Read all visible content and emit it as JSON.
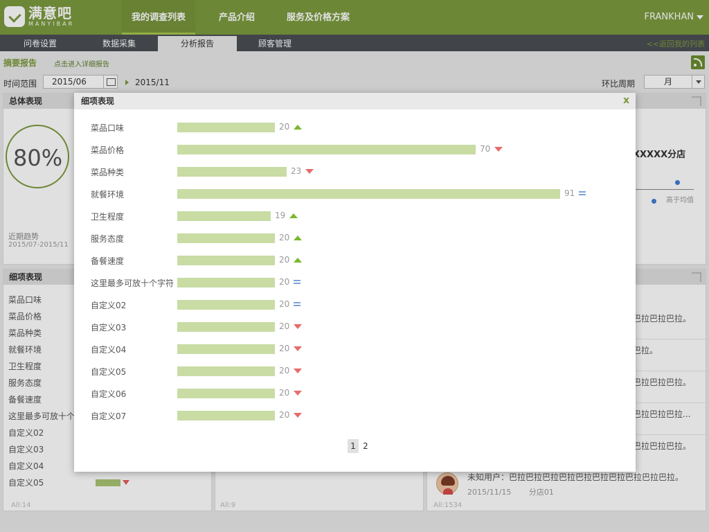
{
  "brand": {
    "name_cn": "满意吧",
    "name_en": "MANYIBAR"
  },
  "nav": {
    "items": [
      {
        "label": "我的调查列表",
        "active": true
      },
      {
        "label": "产品介绍",
        "active": false
      },
      {
        "label": "服务及价格方案",
        "active": false
      }
    ],
    "user": "FRANKHAN"
  },
  "subnav": {
    "tabs": [
      {
        "label": "问卷设置"
      },
      {
        "label": "数据采集"
      },
      {
        "label": "分析报告",
        "active": true
      },
      {
        "label": "顾客管理"
      }
    ],
    "back_link": "<<返回我的列表"
  },
  "summary": {
    "title": "摘要报告",
    "link": "点击进入详细报告"
  },
  "filters": {
    "range_label": "时间范围",
    "start": "2015/06",
    "end": "2015/11",
    "period_label": "环比周期",
    "period_value": "月"
  },
  "overall": {
    "title": "总体表现",
    "score": "80%",
    "trend_label": "近期趋势",
    "trend_range": "2015/07-2015/11"
  },
  "detail_panel": {
    "title": "细项表现",
    "items": [
      "菜品口味",
      "菜品价格",
      "菜品种类",
      "就餐环境",
      "卫生程度",
      "服务态度",
      "备餐速度",
      "这里最多可放十个",
      "自定义02",
      "自定义03",
      "自定义04",
      "自定义05"
    ],
    "footer": "All:14"
  },
  "middle_footer": "All:9",
  "right_panel": {
    "branch": "XXXXX分店",
    "avg_label": "高于均值",
    "snippets": [
      "巴拉巴拉巴拉。",
      "巴拉。",
      "巴拉巴拉巴拉。",
      "巴拉巴拉巴拉...",
      "巴拉巴拉巴拉。"
    ],
    "last_comment": {
      "text": "未知用户：巴拉巴拉巴拉巴拉巴拉巴拉巴拉巴拉巴拉巴拉。",
      "date": "2015/11/15",
      "store": "分店01"
    },
    "footer": "All:1534"
  },
  "modal": {
    "title": "细项表现",
    "close": "x",
    "rows": [
      {
        "label": "菜品口味",
        "value": 20,
        "trend": "up"
      },
      {
        "label": "菜品价格",
        "value": 70,
        "trend": "down"
      },
      {
        "label": "菜品种类",
        "value": 23,
        "trend": "down"
      },
      {
        "label": "就餐环境",
        "value": 91,
        "trend": "equal"
      },
      {
        "label": "卫生程度",
        "value": 19,
        "trend": "up"
      },
      {
        "label": "服务态度",
        "value": 20,
        "trend": "up"
      },
      {
        "label": "备餐速度",
        "value": 20,
        "trend": "up"
      },
      {
        "label": "这里最多可放十个字符",
        "value": 20,
        "trend": "equal"
      },
      {
        "label": "自定义02",
        "value": 20,
        "trend": "equal"
      },
      {
        "label": "自定义03",
        "value": 20,
        "trend": "down"
      },
      {
        "label": "自定义04",
        "value": 20,
        "trend": "down"
      },
      {
        "label": "自定义05",
        "value": 20,
        "trend": "down"
      },
      {
        "label": "自定义06",
        "value": 20,
        "trend": "down"
      },
      {
        "label": "自定义07",
        "value": 20,
        "trend": "down"
      }
    ],
    "pages": [
      "1",
      "2"
    ],
    "current_page": "1"
  },
  "colors": {
    "brand": "#7c9a3e",
    "bar": "#c8dca4",
    "up": "#7cb82f",
    "down": "#e86b6b",
    "equal": "#7aa2d9"
  }
}
